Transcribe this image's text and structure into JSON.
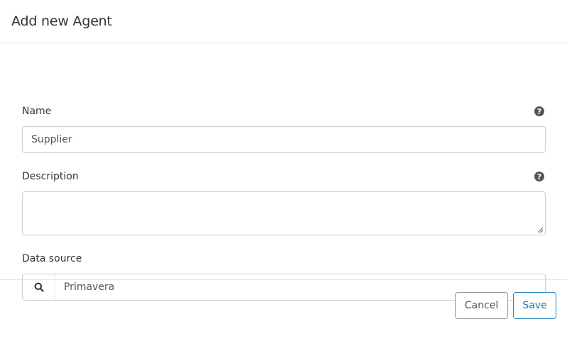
{
  "dialog": {
    "title": "Add new Agent"
  },
  "fields": {
    "name": {
      "label": "Name",
      "value": "Supplier"
    },
    "description": {
      "label": "Description",
      "value": ""
    },
    "data_source": {
      "label": "Data source",
      "value": "Primavera"
    }
  },
  "footer": {
    "cancel_label": "Cancel",
    "save_label": "Save"
  },
  "colors": {
    "save_accent": "#1f77b4",
    "border": "#cccccc",
    "help_icon": "#555555"
  },
  "icons": {
    "help": "question-circle-icon",
    "search": "search-icon",
    "resize": "resize-grip-icon"
  }
}
